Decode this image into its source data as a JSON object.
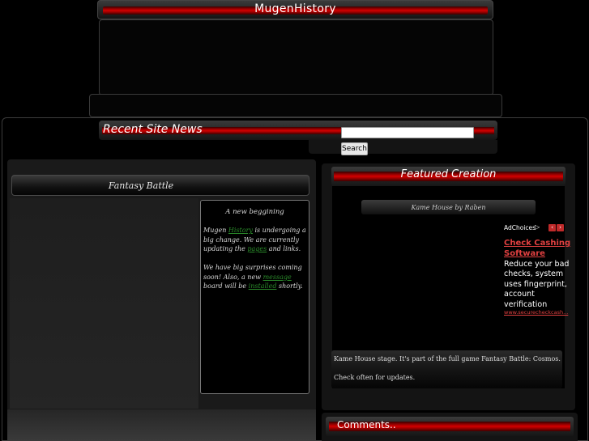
{
  "site": {
    "title": "MugenHistory"
  },
  "news": {
    "title": "Recent Site News"
  },
  "search": {
    "placeholder": "",
    "button_label": "Search"
  },
  "left": {
    "header": "Fantasy Battle",
    "card": {
      "title": "A new beggining",
      "p1_a": "Mugen ",
      "p1_link1": "History",
      "p1_b": " is undergoing a big change. We are currently updating the ",
      "p1_link2": "pages",
      "p1_c": " and links.",
      "p2_a": "We have big surprises coming soon! Also, a new ",
      "p2_link1": "message",
      "p2_b": " board will be ",
      "p2_link2": "installed",
      "p2_c": " shortly."
    }
  },
  "featured": {
    "title": "Featured Creation",
    "item_title": "Kame House by Raben",
    "description_1": "Kame House stage. It's part of the full game Fantasy Battle: Cosmos.",
    "description_2": "Check often for updates."
  },
  "ad": {
    "adchoices": "AdChoices",
    "arrow": "▷",
    "prev": "‹",
    "next": "›",
    "headline": "Check Cashing Software",
    "body": "Reduce your bad checks, system uses fingerprint, account verification",
    "url": "www.securecheckcash..."
  },
  "comments": {
    "title": "Comments.."
  },
  "colors": {
    "accent_red": "#d40000",
    "link_green": "#2a8a2a",
    "ad_red": "#e04040"
  }
}
